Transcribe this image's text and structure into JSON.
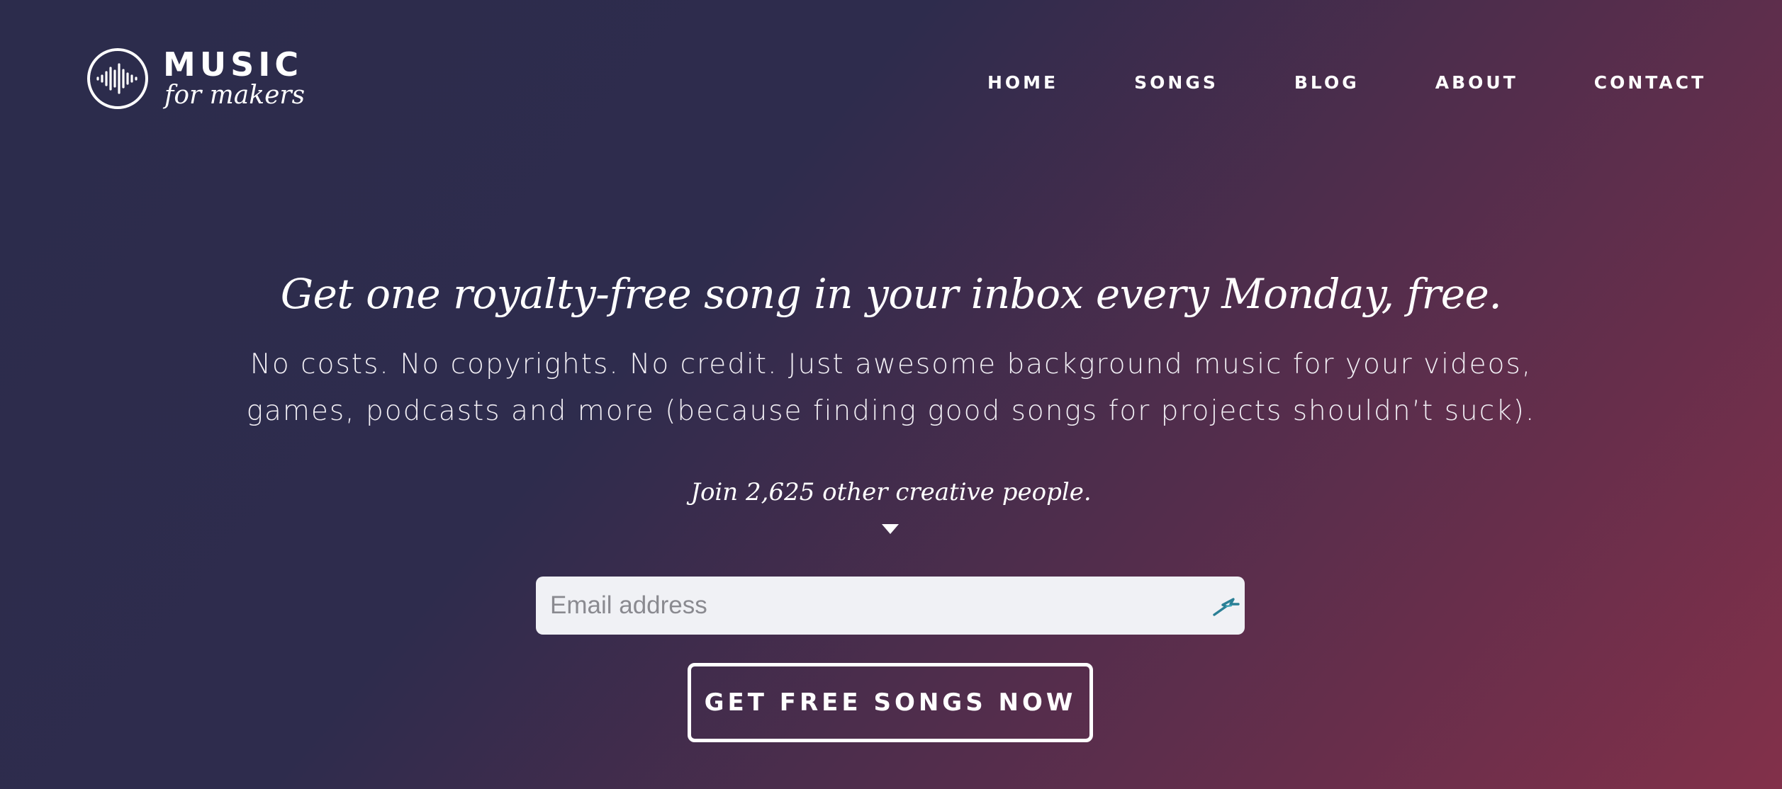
{
  "brand": {
    "title": "MUSIC",
    "subtitle": "for makers",
    "logo_icon": "soundwave-circle-icon"
  },
  "nav": {
    "items": [
      {
        "label": "HOME"
      },
      {
        "label": "SONGS"
      },
      {
        "label": "BLOG"
      },
      {
        "label": "ABOUT"
      },
      {
        "label": "CONTACT"
      }
    ]
  },
  "hero": {
    "headline": "Get one royalty-free song in your inbox every Monday, free.",
    "subtext": "No costs. No copyrights. No credit. Just awesome background music for your videos, games, podcasts and more (because finding good songs for projects shouldn’t suck).",
    "join_text": "Join 2,625 other creative people."
  },
  "signup": {
    "email_placeholder": "Email address",
    "email_value": "",
    "autofill_icon": "password-manager-icon",
    "submit_label": "GET FREE SONGS NOW"
  },
  "colors": {
    "background_start": "#2c2c4c",
    "background_end": "#82304a",
    "text": "#ffffff",
    "input_background": "#f0f1f5",
    "autofill_icon": "#2a7f95"
  }
}
